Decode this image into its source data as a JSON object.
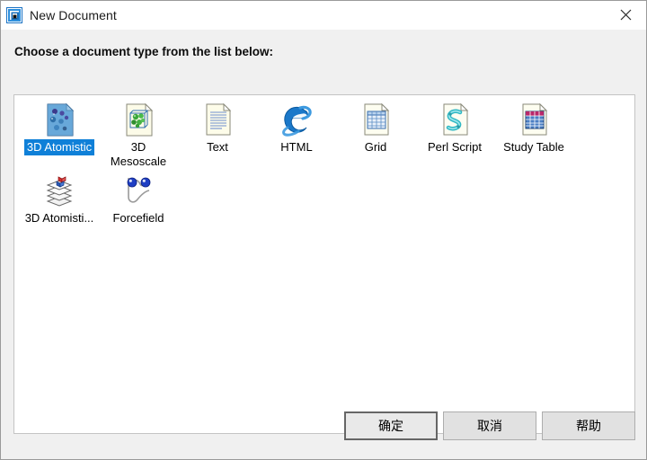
{
  "window": {
    "title": "New Document",
    "icon": "app-window-icon",
    "close_label": "✕"
  },
  "prompt": "Choose a document type from the list below:",
  "list": {
    "items": [
      {
        "label": "3D Atomistic",
        "icon": "atomistic-document-icon",
        "selected": true
      },
      {
        "label": "3D Mesoscale",
        "icon": "mesoscale-document-icon",
        "selected": false
      },
      {
        "label": "Text",
        "icon": "text-document-icon",
        "selected": false
      },
      {
        "label": "HTML",
        "icon": "internet-explorer-icon",
        "selected": false
      },
      {
        "label": "Grid",
        "icon": "grid-document-icon",
        "selected": false
      },
      {
        "label": "Perl Script",
        "icon": "perl-script-icon",
        "selected": false
      },
      {
        "label": "Study Table",
        "icon": "study-table-icon",
        "selected": false
      },
      {
        "label": "3D Atomisti...",
        "icon": "layers-icon",
        "selected": false
      },
      {
        "label": "Forcefield",
        "icon": "forcefield-icon",
        "selected": false
      }
    ]
  },
  "buttons": {
    "ok": "确定",
    "cancel": "取消",
    "help": "帮助"
  },
  "colors": {
    "selection_blue": "#0f80d8",
    "dialog_bg": "#f0f0f0",
    "panel_bg": "#ffffff",
    "button_bg": "#e1e1e1"
  }
}
